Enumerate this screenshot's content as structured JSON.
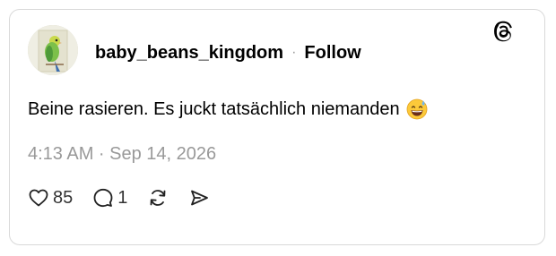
{
  "post": {
    "username": "baby_beans_kingdom",
    "separator": "·",
    "follow_label": "Follow",
    "text": "Beine rasieren. Es juckt tatsächlich niemanden",
    "emoji": "grinning-sweat-emoji",
    "timestamp": "4:13 AM · Sep 14, 2026",
    "like_count": "85",
    "reply_count": "1"
  },
  "icons": {
    "logo": "threads-logo-icon",
    "like": "heart-icon",
    "reply": "comment-icon",
    "repost": "repost-icon",
    "share": "send-icon"
  },
  "colors": {
    "text": "#000000",
    "muted": "#999999",
    "border": "#d9d9d9",
    "background": "#ffffff"
  }
}
